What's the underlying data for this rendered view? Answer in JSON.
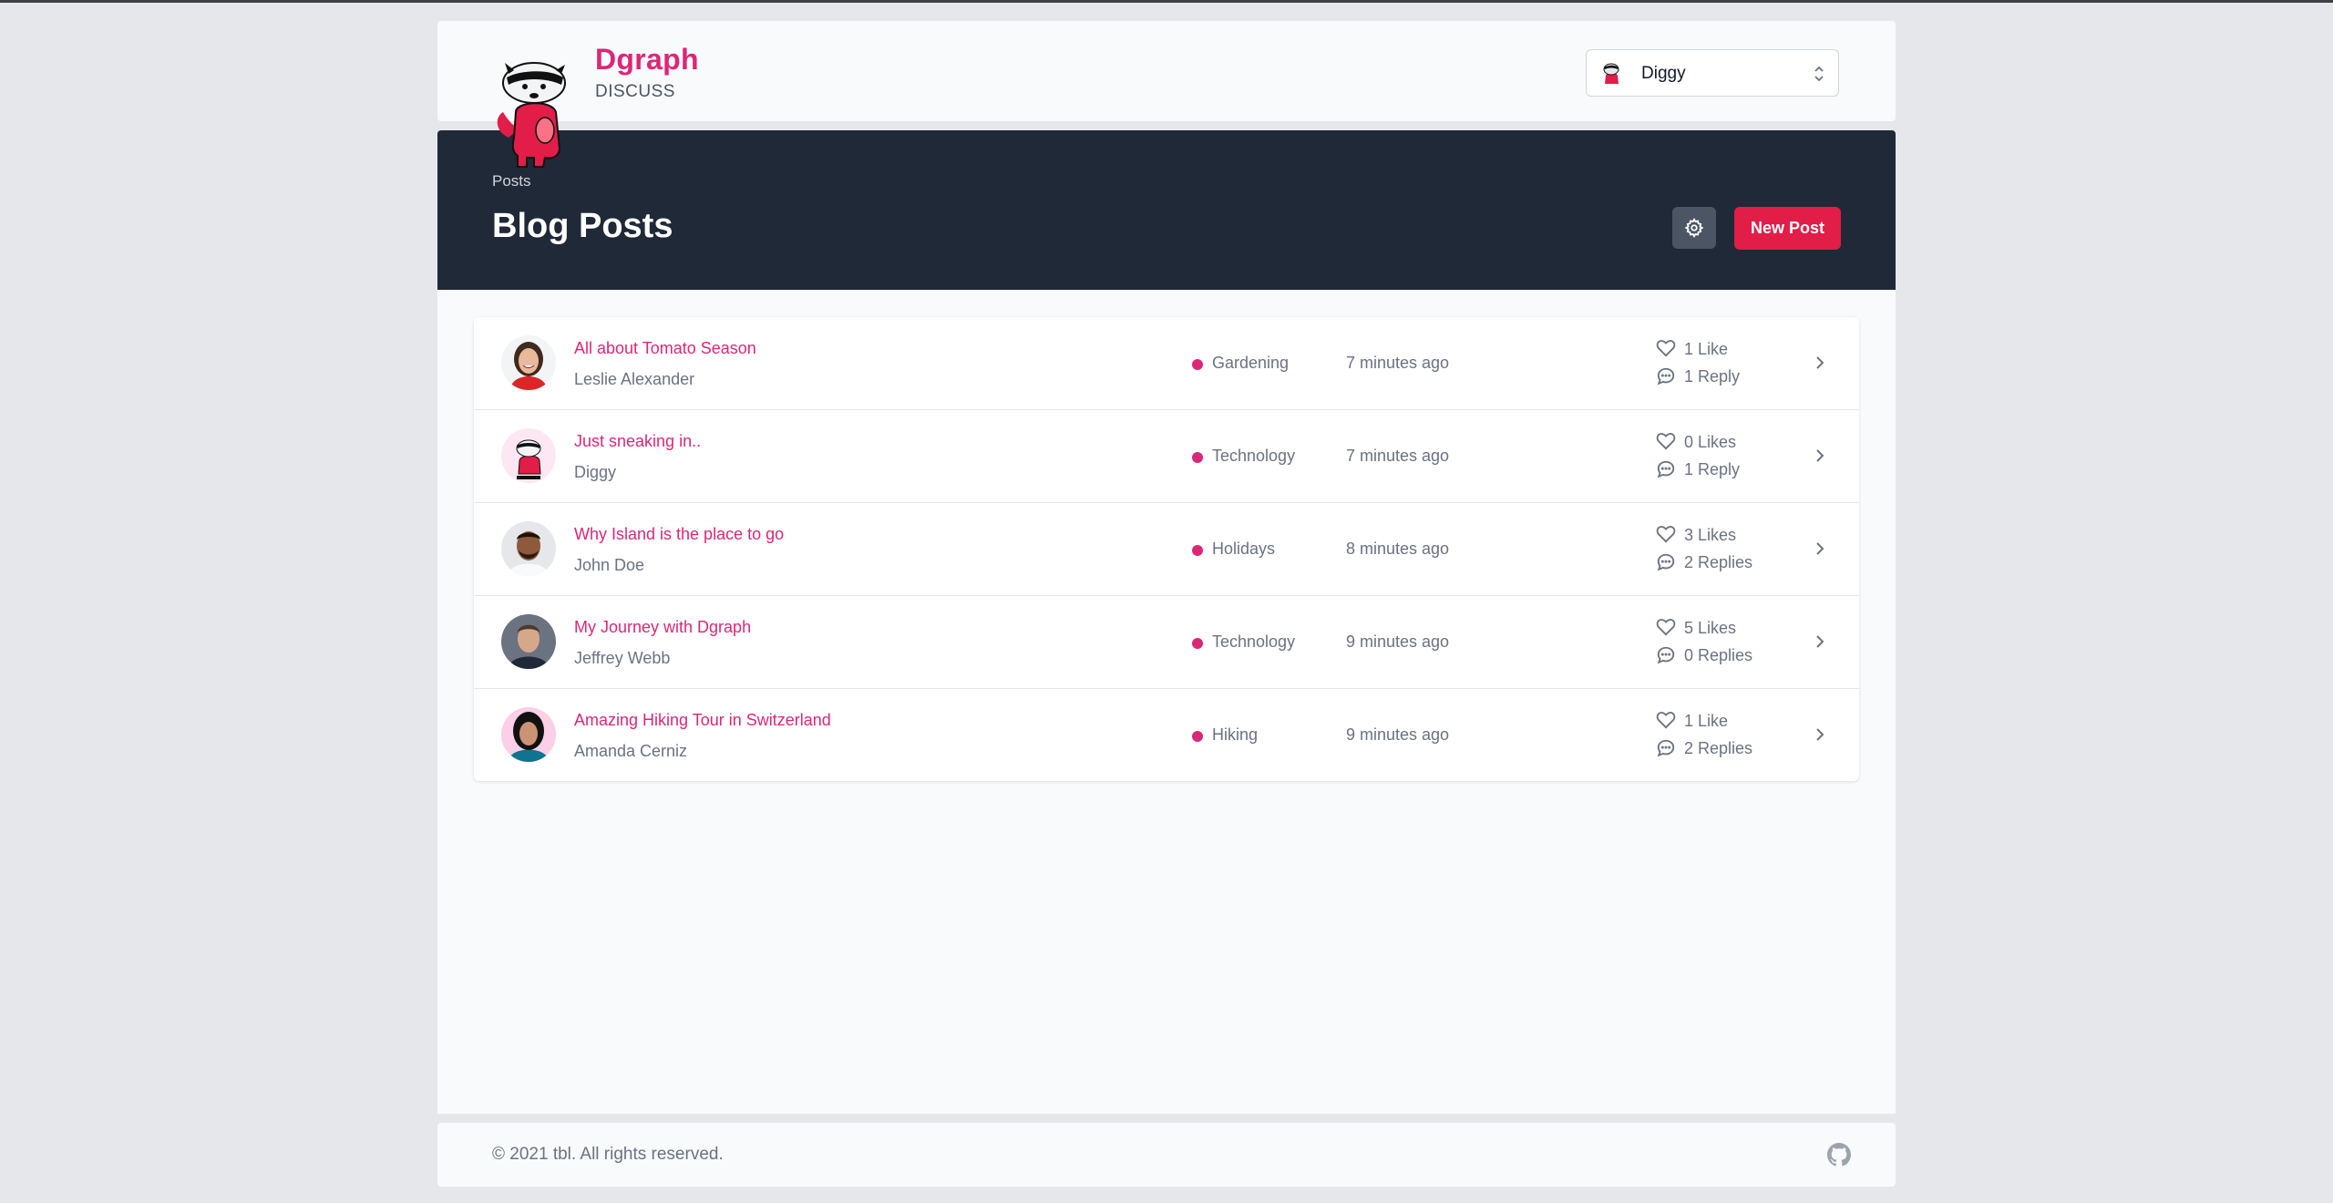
{
  "brand": {
    "name": "Dgraph",
    "sub": "DISCUSS"
  },
  "user_select": {
    "selected": "Diggy"
  },
  "banner": {
    "breadcrumb": "Posts",
    "title": "Blog Posts",
    "new_post_label": "New Post"
  },
  "posts": [
    {
      "title": "All about Tomato Season",
      "author": "Leslie Alexander",
      "category": "Gardening",
      "time": "7 minutes ago",
      "likes": "1 Like",
      "replies": "1 Reply"
    },
    {
      "title": "Just sneaking in..",
      "author": "Diggy",
      "category": "Technology",
      "time": "7 minutes ago",
      "likes": "0 Likes",
      "replies": "1 Reply"
    },
    {
      "title": "Why Island is the place to go",
      "author": "John Doe",
      "category": "Holidays",
      "time": "8 minutes ago",
      "likes": "3 Likes",
      "replies": "2 Replies"
    },
    {
      "title": "My Journey with Dgraph",
      "author": "Jeffrey Webb",
      "category": "Technology",
      "time": "9 minutes ago",
      "likes": "5 Likes",
      "replies": "0 Replies"
    },
    {
      "title": "Amazing Hiking Tour in Switzerland",
      "author": "Amanda Cerniz",
      "category": "Hiking",
      "time": "9 minutes ago",
      "likes": "1 Like",
      "replies": "2 Replies"
    }
  ],
  "footer": {
    "copyright": "© 2021 tbl. All rights reserved."
  },
  "colors": {
    "accent": "#db2777",
    "button": "#e11d48",
    "banner": "#1f2937"
  }
}
